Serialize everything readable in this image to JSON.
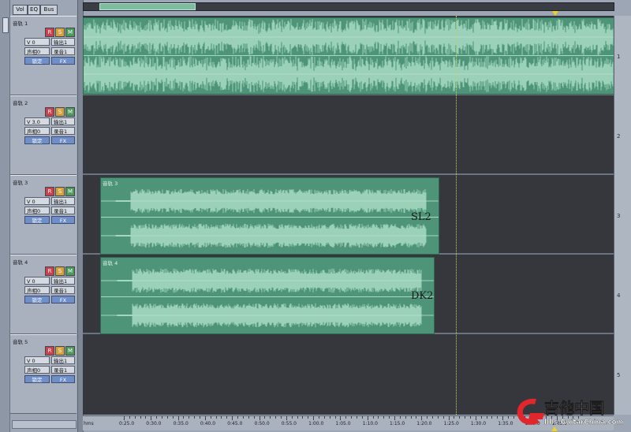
{
  "modes": [
    "Vol",
    "EQ",
    "Bus"
  ],
  "tracks": [
    {
      "name": "音轨 1",
      "vol": "V 0",
      "pan": "声相0",
      "out": "输出1",
      "rec": "录音1",
      "lock": "锁定",
      "fx": "FX",
      "r": "R",
      "s": "S",
      "m": "M",
      "num": "1"
    },
    {
      "name": "音轨 2",
      "vol": "V 3.0",
      "pan": "声相0",
      "out": "输出1",
      "rec": "录音1",
      "lock": "锁定",
      "fx": "FX",
      "r": "R",
      "s": "S",
      "m": "M",
      "num": "2"
    },
    {
      "name": "音轨 3",
      "vol": "V 0",
      "pan": "声相0",
      "out": "输出1",
      "rec": "录音1",
      "lock": "锁定",
      "fx": "FX",
      "r": "R",
      "s": "S",
      "m": "M",
      "num": "3"
    },
    {
      "name": "音轨 4",
      "vol": "V 0",
      "pan": "声相0",
      "out": "输出1",
      "rec": "录音1",
      "lock": "锁定",
      "fx": "FX",
      "r": "R",
      "s": "S",
      "m": "M",
      "num": "4"
    },
    {
      "name": "音轨 5",
      "vol": "V 0",
      "pan": "声相0",
      "out": "输出1",
      "rec": "录音1",
      "lock": "锁定",
      "fx": "FX",
      "r": "R",
      "s": "S",
      "m": "M",
      "num": "5"
    }
  ],
  "clips": [
    {
      "title": "音轨 3",
      "annotation": "SL2"
    },
    {
      "title": "音轨 4",
      "annotation": "DK2"
    }
  ],
  "ruler": {
    "unit": "hms",
    "labels": [
      "0:25.0",
      "0:30.0",
      "0:35.0",
      "0:40.0",
      "0:45.0",
      "0:50.0",
      "0:55.0",
      "1:00.0",
      "1:05.0",
      "1:10.0",
      "1:15.0",
      "1:20.0",
      "1:25.0",
      "1:30.0",
      "1:35.0",
      "1:40.0",
      "1:45.0"
    ]
  },
  "watermark": {
    "brand": "吉他中国",
    "url": "bbs.GuitarChina.com"
  },
  "colors": {
    "clip": "#4e9478",
    "wave": "#9fd4bd",
    "record": "#c8414b",
    "solo": "#d8a23a",
    "mute": "#4d9a5a"
  }
}
